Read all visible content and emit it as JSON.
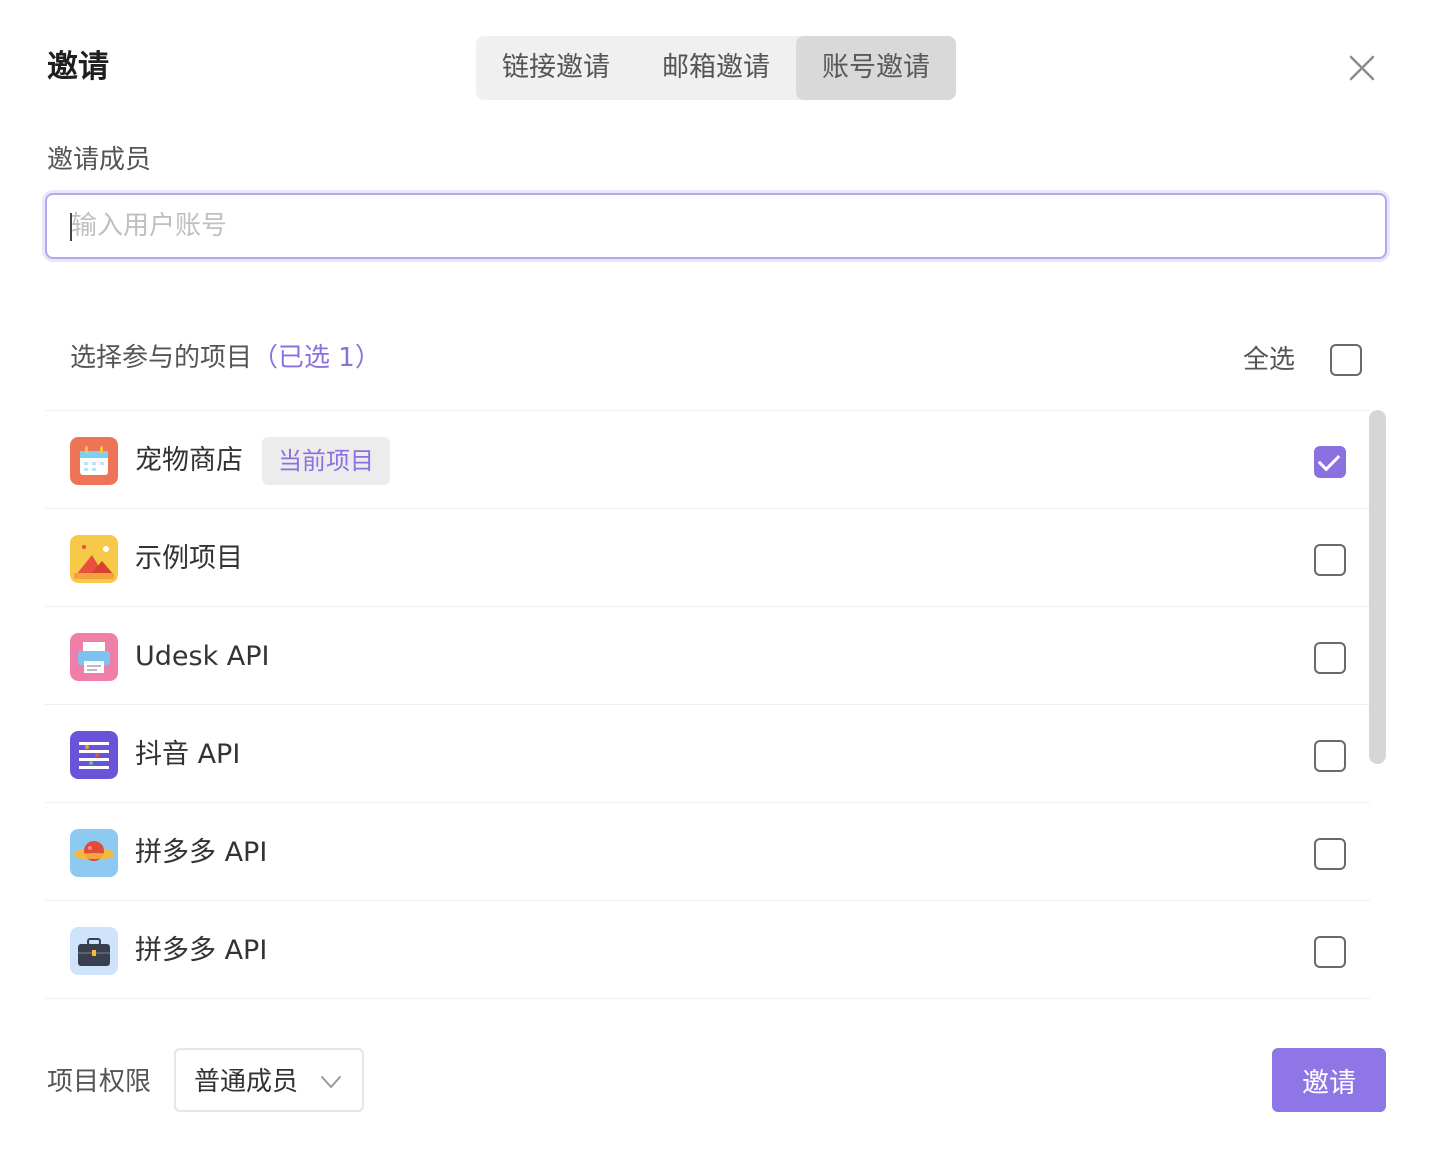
{
  "dialog": {
    "title": "邀请",
    "tabs": [
      {
        "label": "链接邀请",
        "active": false
      },
      {
        "label": "邮箱邀请",
        "active": false
      },
      {
        "label": "账号邀请",
        "active": true
      }
    ]
  },
  "members": {
    "label": "邀请成员",
    "placeholder": "输入用户账号",
    "value": ""
  },
  "projects": {
    "heading": "选择参与的项目",
    "selected_count_text": "（已选 1）",
    "select_all_label": "全选",
    "select_all_checked": false,
    "items": [
      {
        "name": "宠物商店",
        "tag": "当前项目",
        "checked": true,
        "icon": "calendar-icon"
      },
      {
        "name": "示例项目",
        "tag": "",
        "checked": false,
        "icon": "mountain-icon"
      },
      {
        "name": "Udesk API",
        "tag": "",
        "checked": false,
        "icon": "printer-icon"
      },
      {
        "name": "抖音 API",
        "tag": "",
        "checked": false,
        "icon": "list-icon"
      },
      {
        "name": "拼多多 API",
        "tag": "",
        "checked": false,
        "icon": "planet-icon"
      },
      {
        "name": "拼多多 API",
        "tag": "",
        "checked": false,
        "icon": "briefcase-icon"
      }
    ]
  },
  "permission": {
    "label": "项目权限",
    "value": "普通成员"
  },
  "actions": {
    "invite_label": "邀请"
  },
  "colors": {
    "accent": "#8a70e0",
    "button": "#8f76e6"
  }
}
